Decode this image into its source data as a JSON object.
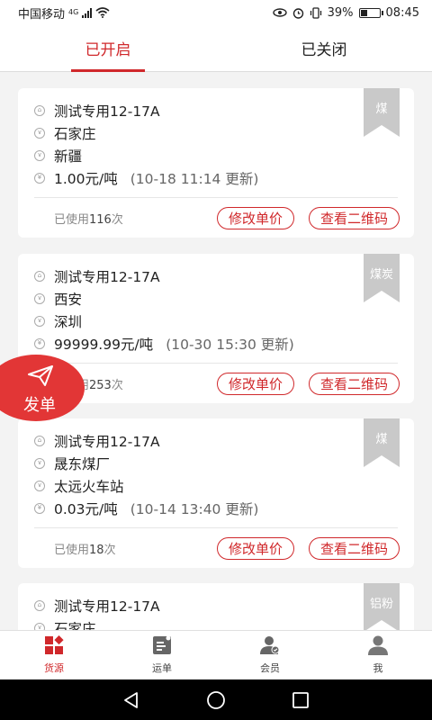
{
  "status": {
    "carrier": "中国移动",
    "network": "4G",
    "battery": "39%",
    "battery_level": 0.39,
    "time": "08:45"
  },
  "tabs": [
    {
      "label": "已开启",
      "active": true
    },
    {
      "label": "已关闭",
      "active": false
    }
  ],
  "cards": [
    {
      "name": "测试专用12-17A",
      "origin": "石家庄",
      "destination": "新疆",
      "price": "1.00元/吨",
      "updated": "(10-18  11:14 更新)",
      "tag": "煤",
      "used_label": "已使用",
      "used_count": "116",
      "used_unit": "次"
    },
    {
      "name": "测试专用12-17A",
      "origin": "西安",
      "destination": "深圳",
      "price": "99999.99元/吨",
      "updated": "(10-30  15:30 更新)",
      "tag": "煤炭",
      "used_label": "已使用",
      "used_count": "253",
      "used_unit": "次"
    },
    {
      "name": "测试专用12-17A",
      "origin": "晟东煤厂",
      "destination": "太远火车站",
      "price": "0.03元/吨",
      "updated": "(10-14  13:40 更新)",
      "tag": "煤",
      "used_label": "已使用",
      "used_count": "18",
      "used_unit": "次"
    },
    {
      "name": "测试专用12-17A",
      "origin": "石家庄",
      "tag": "铝粉"
    }
  ],
  "card_buttons": {
    "edit_price": "修改单价",
    "view_qr": "查看二维码"
  },
  "fab": {
    "label": "发单"
  },
  "bottom_nav": [
    {
      "label": "货源",
      "icon": "grid-icon",
      "active": true
    },
    {
      "label": "运单",
      "icon": "waybill-icon",
      "active": false
    },
    {
      "label": "会员",
      "icon": "member-icon",
      "active": false
    },
    {
      "label": "我",
      "icon": "person-icon",
      "active": false
    }
  ],
  "colors": {
    "accent": "#d0282b",
    "fab": "#e23636",
    "ribbon": "#c9c9c9"
  }
}
